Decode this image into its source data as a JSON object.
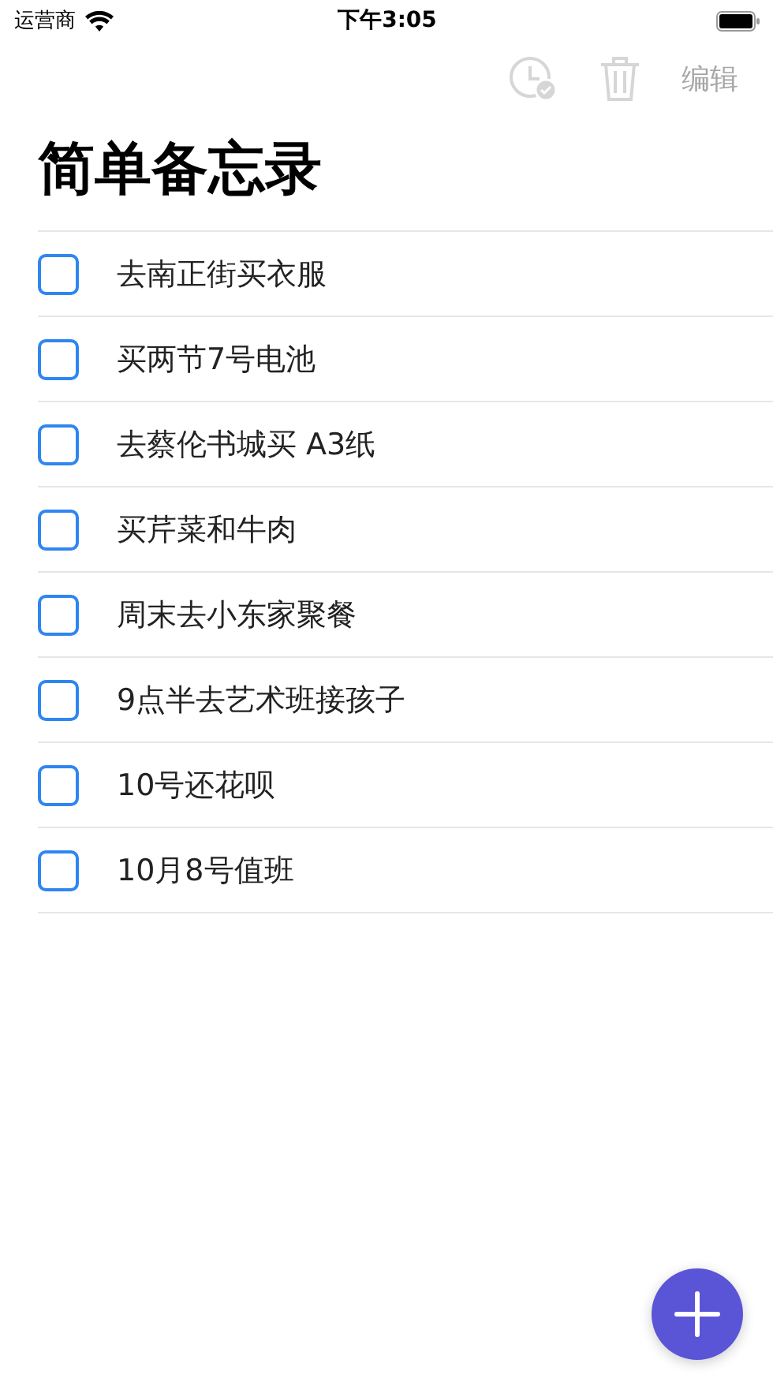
{
  "status_bar": {
    "carrier": "运营商",
    "time": "下午3:05"
  },
  "toolbar": [
    {
      "kind": "history",
      "disabled": true
    },
    {
      "kind": "trash",
      "disabled": true
    },
    {
      "kind": "text",
      "label": "编辑",
      "disabled": true
    }
  ],
  "title": "简单备忘录",
  "items": [
    {
      "text": "去南正街买衣服",
      "checked": false
    },
    {
      "text": "买两节7号电池",
      "checked": false
    },
    {
      "text": "去蔡伦书城买 A3纸",
      "checked": false
    },
    {
      "text": "买芹菜和牛肉",
      "checked": false
    },
    {
      "text": "周末去小东家聚餐",
      "checked": false
    },
    {
      "text": "9点半去艺术班接孩子",
      "checked": false
    },
    {
      "text": "10号还花呗",
      "checked": false
    },
    {
      "text": "10月8号值班",
      "checked": false
    }
  ]
}
